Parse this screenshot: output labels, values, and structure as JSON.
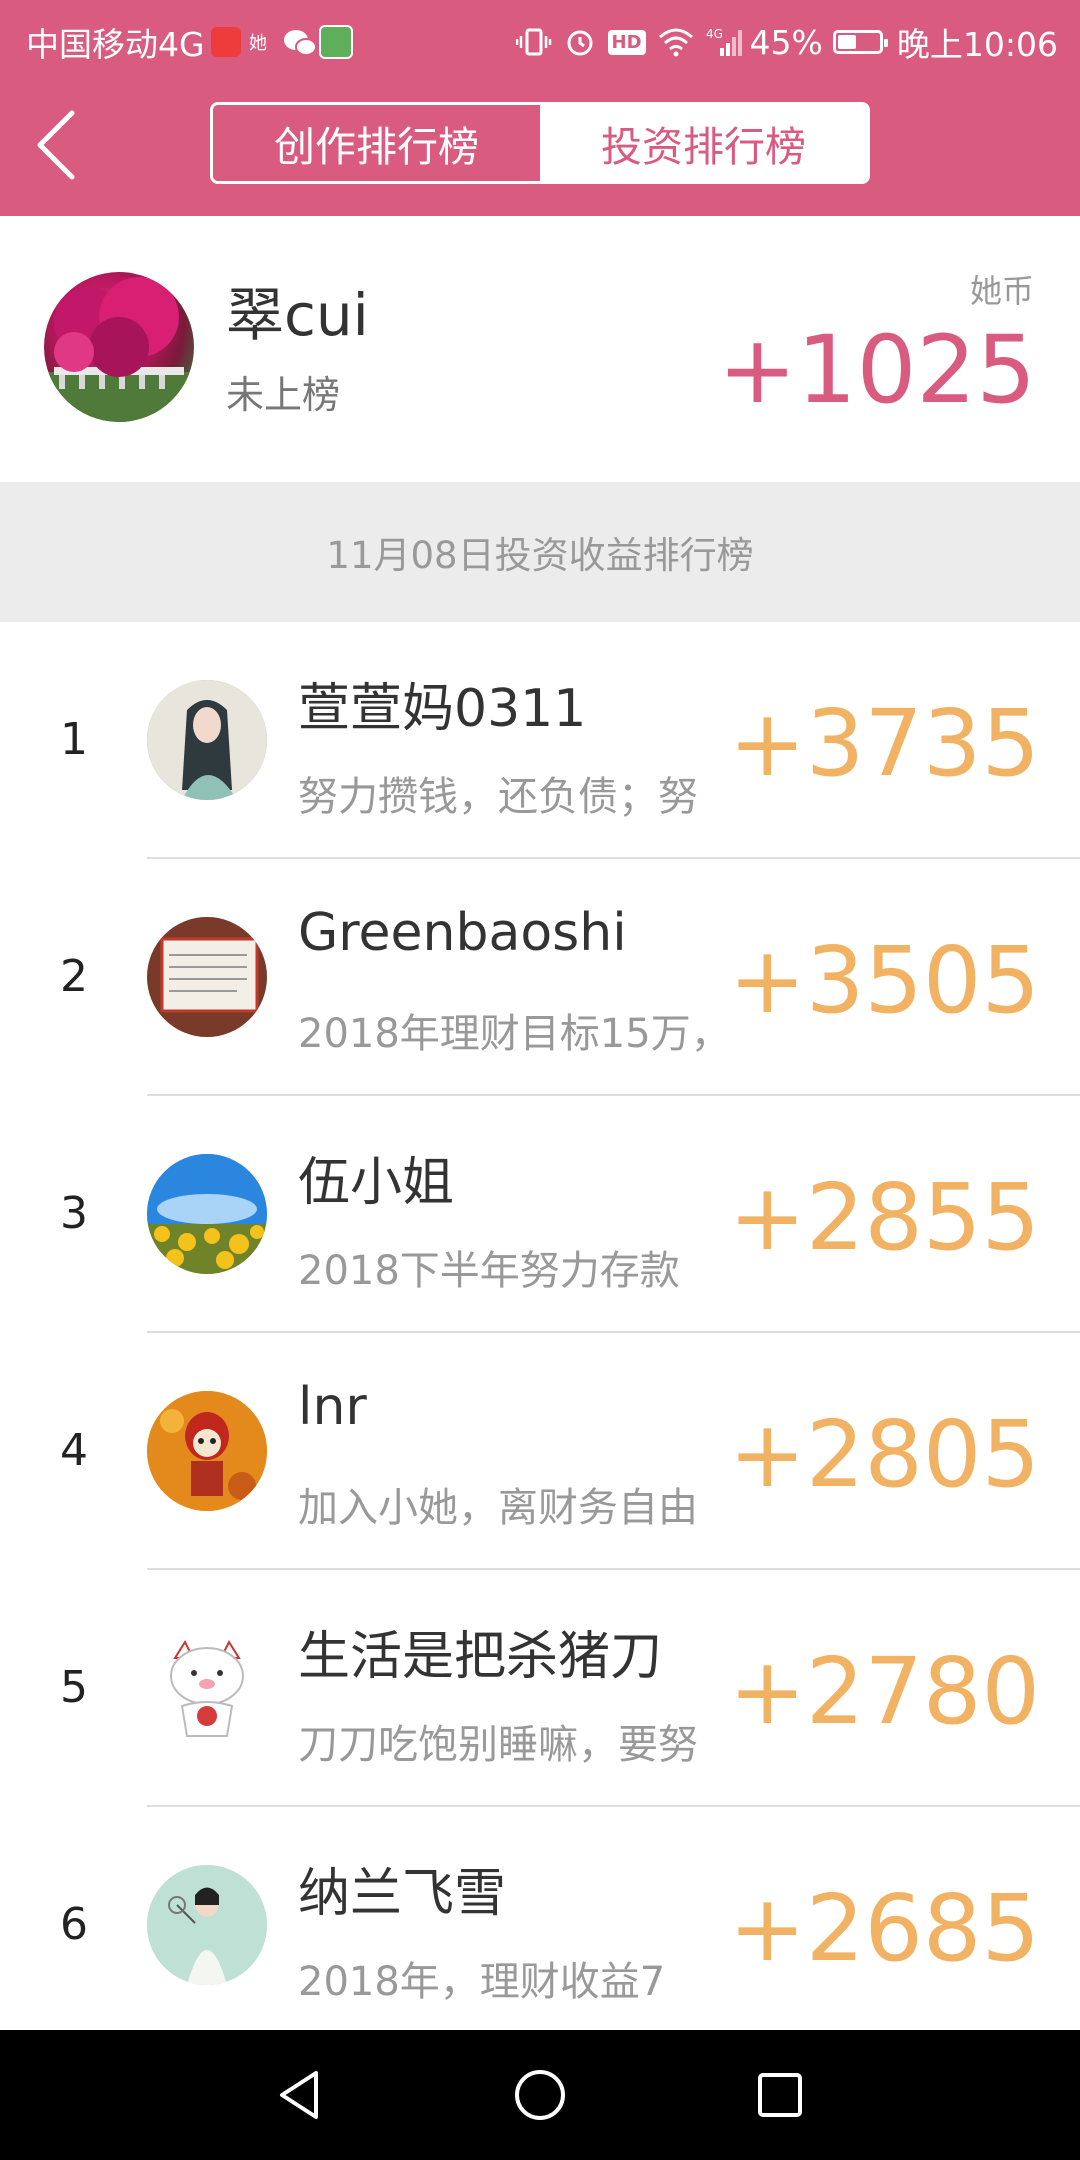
{
  "status_bar": {
    "carrier": "中国移动4G",
    "network": "4G",
    "battery_percent": "45%",
    "battery_level": 0.45,
    "time": "晚上10:06",
    "hd_label": "HD",
    "app_icons": [
      "toutiao-icon",
      "tahui-icon",
      "wechat-icon",
      "green-app-icon"
    ]
  },
  "nav": {
    "tabs": [
      {
        "label": "创作排行榜",
        "active": true
      },
      {
        "label": "投资排行榜",
        "active": false
      }
    ]
  },
  "me": {
    "name": "翠cui",
    "status": "未上榜",
    "coin_label": "她币",
    "coin_value": "+1025"
  },
  "date_banner": "11月08日投资收益排行榜",
  "ranking": [
    {
      "rank": "1",
      "name": "萱萱妈0311",
      "motto": "努力攒钱，还负债；努",
      "gain": "+3735"
    },
    {
      "rank": "2",
      "name": "Greenbaoshi",
      "motto": "2018年理财目标15万，",
      "gain": "+3505"
    },
    {
      "rank": "3",
      "name": "伍小姐",
      "motto": "2018下半年努力存款",
      "gain": "+2855"
    },
    {
      "rank": "4",
      "name": "lnr",
      "motto": "加入小她，离财务自由",
      "gain": "+2805"
    },
    {
      "rank": "5",
      "name": "生活是把杀猪刀",
      "motto": "刀刀吃饱别睡嘛，要努",
      "gain": "+2780"
    },
    {
      "rank": "6",
      "name": "纳兰飞雪",
      "motto": "2018年，理财收益7",
      "gain": "+2685"
    }
  ],
  "colors": {
    "brand": "#d95b80",
    "gain": "#f2b263",
    "banner_bg": "#ececec"
  }
}
